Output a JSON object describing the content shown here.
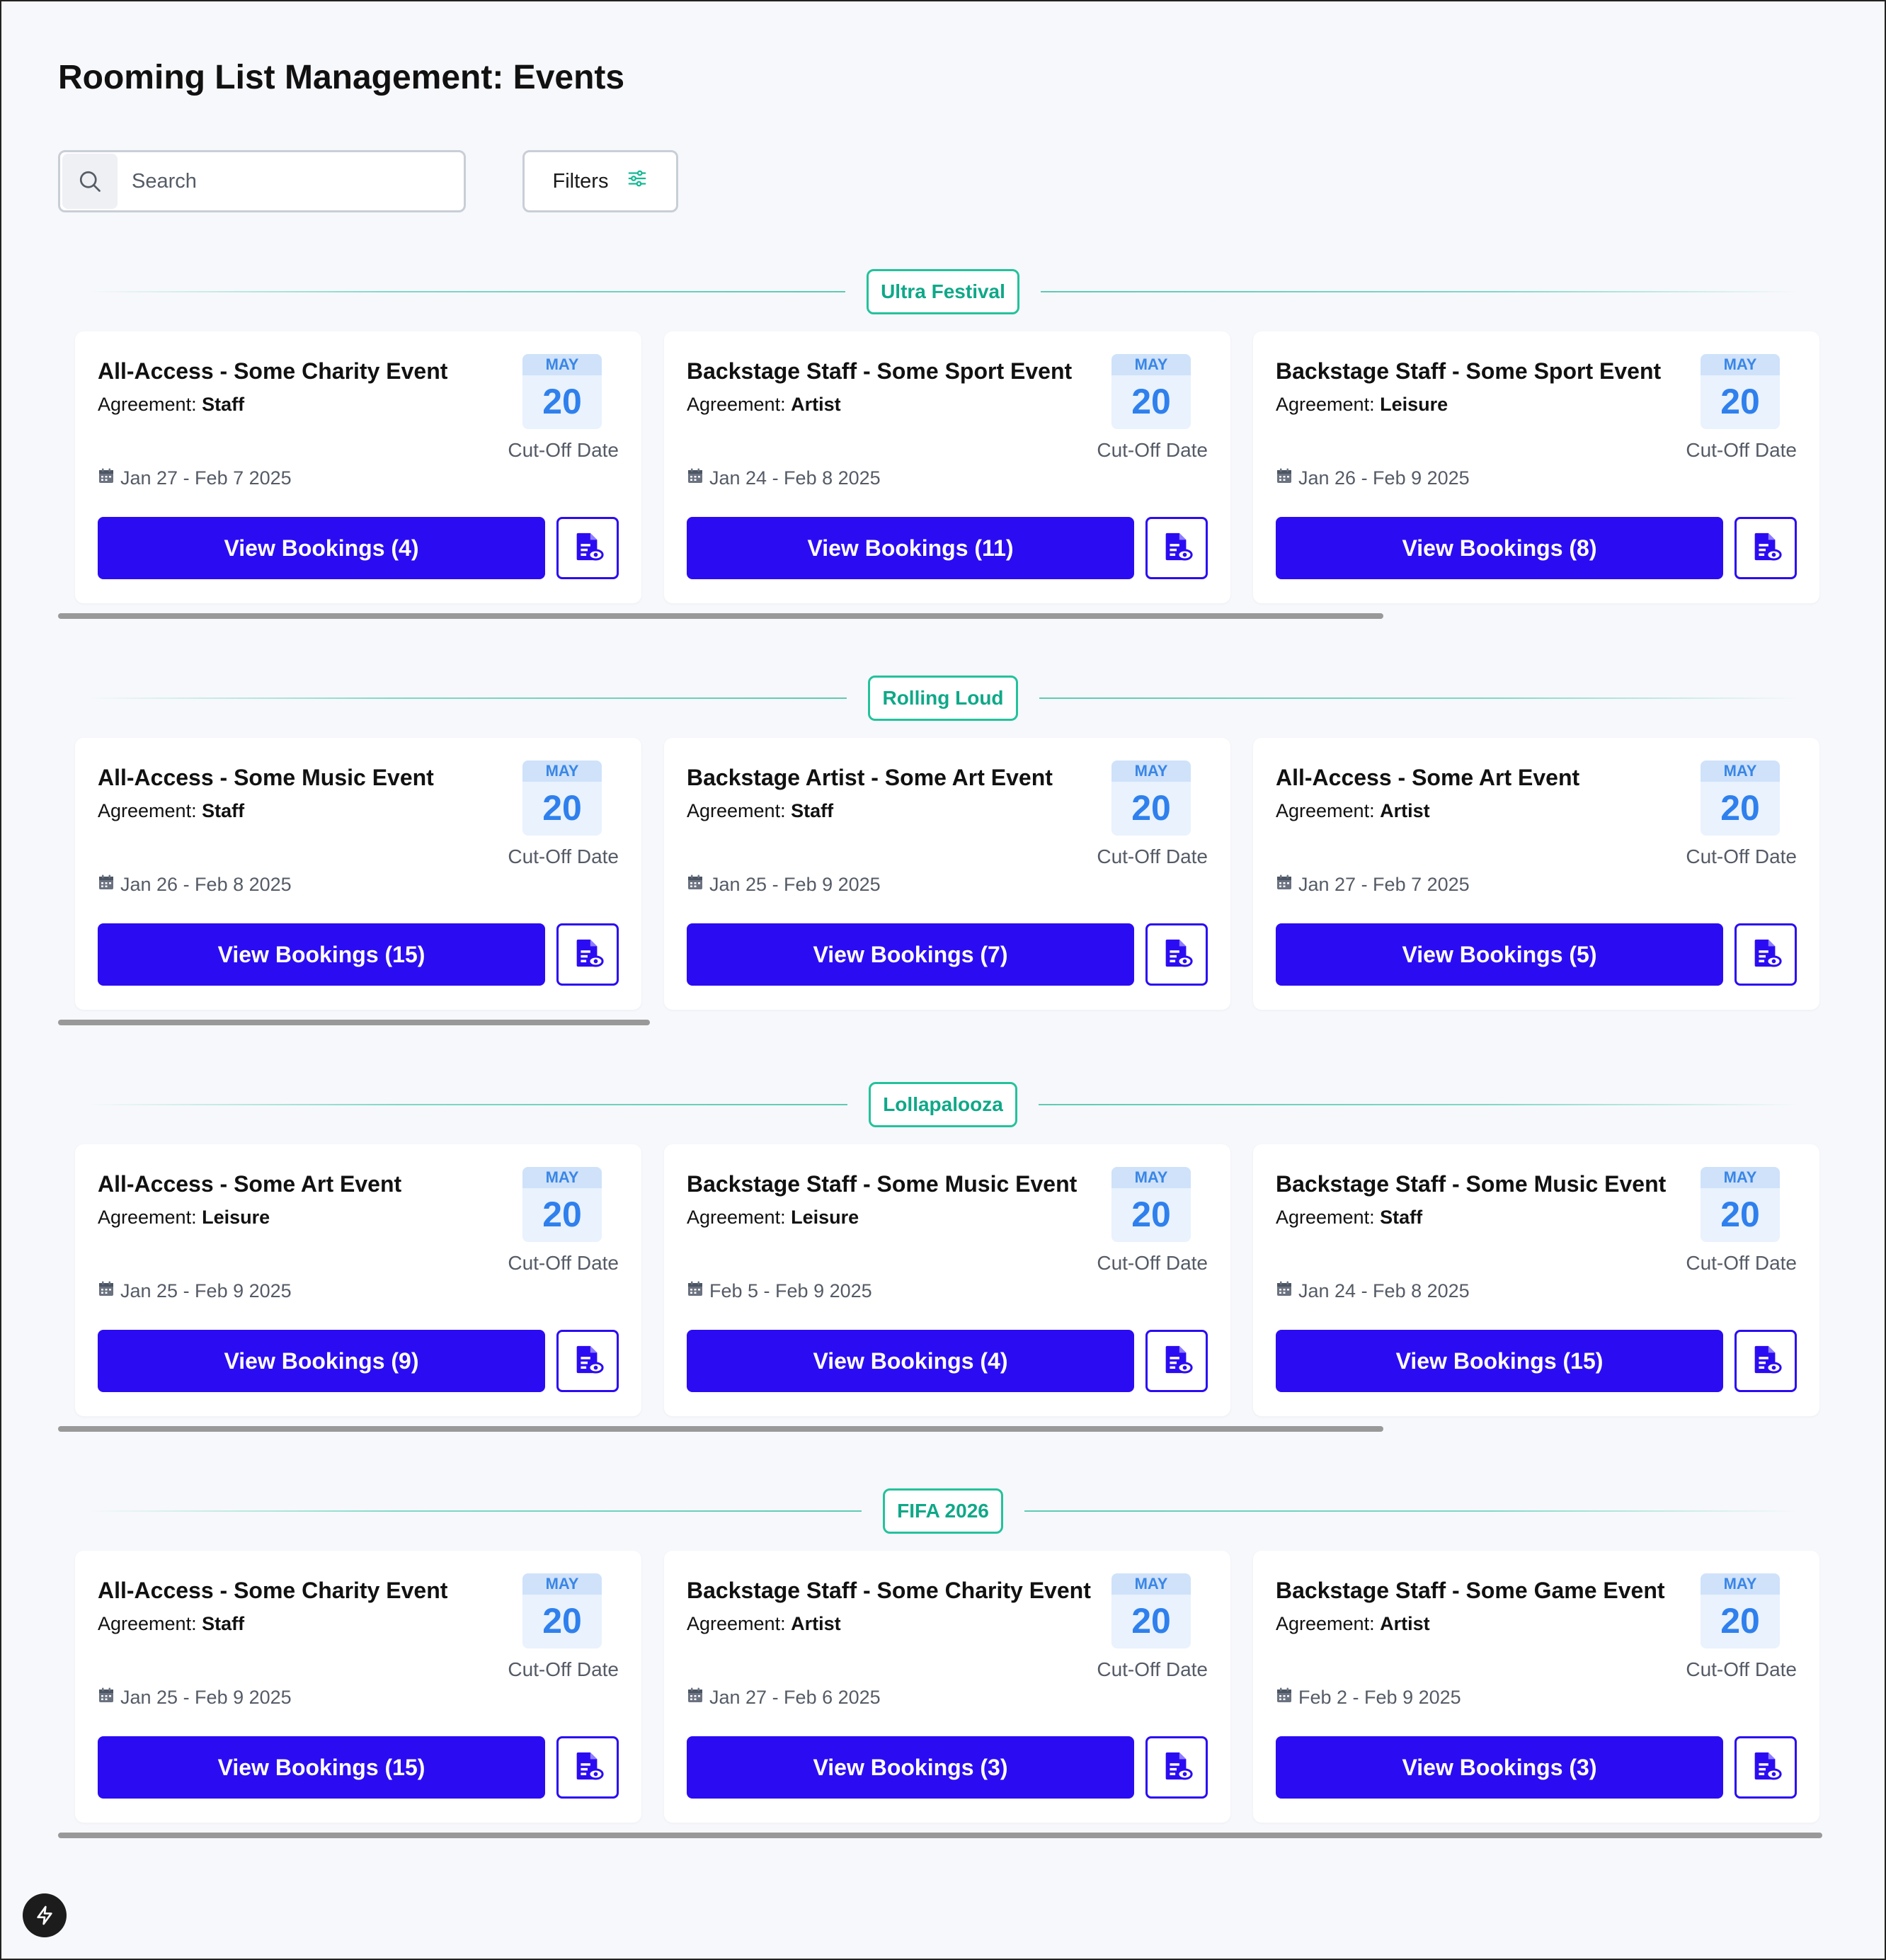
{
  "page": {
    "title": "Rooming List Management: Events"
  },
  "search": {
    "placeholder": "Search"
  },
  "filters": {
    "label": "Filters"
  },
  "colors": {
    "accent": "#2b0cf2",
    "badge_green": "#24c29c",
    "date_blue": "#2f80ed"
  },
  "groups": [
    {
      "name": "Ultra Festival",
      "cards": [
        {
          "title": "All-Access - Some Charity Event",
          "agreement_label": "Agreement:",
          "agreement": "Staff",
          "month": "MAY",
          "day": "20",
          "cutoff": "Cut-Off Date",
          "range": "Jan 27 - Feb 7 2025",
          "button": "View Bookings (4)"
        },
        {
          "title": "Backstage Staff - Some Sport Event",
          "agreement_label": "Agreement:",
          "agreement": "Artist",
          "month": "MAY",
          "day": "20",
          "cutoff": "Cut-Off Date",
          "range": "Jan 24 - Feb 8 2025",
          "button": "View Bookings (11)"
        },
        {
          "title": "Backstage Staff - Some Sport Event",
          "agreement_label": "Agreement:",
          "agreement": "Leisure",
          "month": "MAY",
          "day": "20",
          "cutoff": "Cut-Off Date",
          "range": "Jan 26 - Feb 9 2025",
          "button": "View Bookings (8)"
        }
      ]
    },
    {
      "name": "Rolling Loud",
      "cards": [
        {
          "title": "All-Access - Some Music Event",
          "agreement_label": "Agreement:",
          "agreement": "Staff",
          "month": "MAY",
          "day": "20",
          "cutoff": "Cut-Off Date",
          "range": "Jan 26 - Feb 8 2025",
          "button": "View Bookings (15)"
        },
        {
          "title": "Backstage Artist - Some Art Event",
          "agreement_label": "Agreement:",
          "agreement": "Staff",
          "month": "MAY",
          "day": "20",
          "cutoff": "Cut-Off Date",
          "range": "Jan 25 - Feb 9 2025",
          "button": "View Bookings (7)"
        },
        {
          "title": "All-Access - Some Art Event",
          "agreement_label": "Agreement:",
          "agreement": "Artist",
          "month": "MAY",
          "day": "20",
          "cutoff": "Cut-Off Date",
          "range": "Jan 27 - Feb 7 2025",
          "button": "View Bookings (5)"
        }
      ]
    },
    {
      "name": "Lollapalooza",
      "cards": [
        {
          "title": "All-Access - Some Art Event",
          "agreement_label": "Agreement:",
          "agreement": "Leisure",
          "month": "MAY",
          "day": "20",
          "cutoff": "Cut-Off Date",
          "range": "Jan 25 - Feb 9 2025",
          "button": "View Bookings (9)"
        },
        {
          "title": "Backstage Staff - Some Music Event",
          "agreement_label": "Agreement:",
          "agreement": "Leisure",
          "month": "MAY",
          "day": "20",
          "cutoff": "Cut-Off Date",
          "range": "Feb 5 - Feb 9 2025",
          "button": "View Bookings (4)"
        },
        {
          "title": "Backstage Staff - Some Music Event",
          "agreement_label": "Agreement:",
          "agreement": "Staff",
          "month": "MAY",
          "day": "20",
          "cutoff": "Cut-Off Date",
          "range": "Jan 24 - Feb 8 2025",
          "button": "View Bookings (15)"
        }
      ]
    },
    {
      "name": "FIFA 2026",
      "cards": [
        {
          "title": "All-Access - Some Charity Event",
          "agreement_label": "Agreement:",
          "agreement": "Staff",
          "month": "MAY",
          "day": "20",
          "cutoff": "Cut-Off Date",
          "range": "Jan 25 - Feb 9 2025",
          "button": "View Bookings (15)"
        },
        {
          "title": "Backstage Staff - Some Charity Event",
          "agreement_label": "Agreement:",
          "agreement": "Artist",
          "month": "MAY",
          "day": "20",
          "cutoff": "Cut-Off Date",
          "range": "Jan 27 - Feb 6 2025",
          "button": "View Bookings (3)"
        },
        {
          "title": "Backstage Staff - Some Game Event",
          "agreement_label": "Agreement:",
          "agreement": "Artist",
          "month": "MAY",
          "day": "20",
          "cutoff": "Cut-Off Date",
          "range": "Feb 2 - Feb 9 2025",
          "button": "View Bookings (3)"
        }
      ]
    }
  ]
}
